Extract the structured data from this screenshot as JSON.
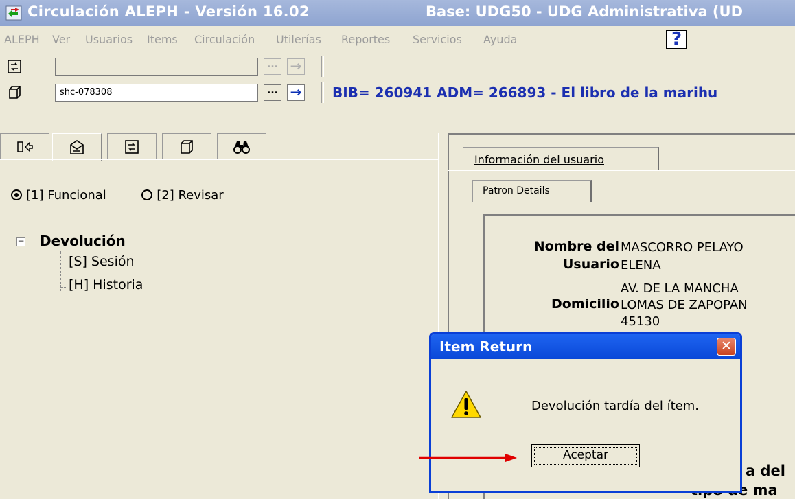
{
  "window": {
    "title": "Circulación ALEPH - Versión 16.02",
    "base": "Base:  UDG50 - UDG Administrativa (UD"
  },
  "menu": {
    "items": [
      "ALEPH",
      "Ver",
      "Usuarios",
      "Items",
      "Circulación",
      "Utilerías",
      "Reportes",
      "Servicios",
      "Ayuda"
    ],
    "help_label": "?"
  },
  "toolbar1": {
    "input_value": "",
    "dots_label": "...",
    "go_label": "→"
  },
  "toolbar2": {
    "input_value": "shc-078308",
    "dots_label": "...",
    "go_label": "→",
    "bib_info": "BIB= 260941 ADM= 266893 - El libro de la marihu"
  },
  "left_panel": {
    "tab_icons": [
      "return-icon",
      "mail-icon",
      "swap-icon",
      "window-icon",
      "binoculars-icon"
    ],
    "radio_functional": "[1] Funcional",
    "radio_review": "[2] Revisar",
    "tree_toggle": "−",
    "tree_root": "Devolución",
    "tree_children": [
      "[S] Sesión",
      "[H] Historia"
    ]
  },
  "right_panel": {
    "tab_user_info": "Información del usuario",
    "tab_patron_details": "Patron Details",
    "name_label_1": "Nombre del",
    "name_label_2": "Usuario",
    "name_value_1": "MASCORRO PELAYO",
    "name_value_2": "ELENA",
    "address_label": "Domicilio",
    "address_line_1": "AV. DE LA MANCHA",
    "address_line_2": "LOMAS DE ZAPOPAN",
    "address_line_3": "45130",
    "bottom_label_1": "a del",
    "bottom_label_2": "tipo de ma"
  },
  "dialog": {
    "title": "Item Return",
    "close_label": "✕",
    "message": "Devolución tardía del ítem.",
    "ok_label": "Aceptar"
  },
  "colors": {
    "titlebar": "#8ea4d0",
    "bib_text": "#1b2fb0",
    "dialog_title": "#0a48d8",
    "annotation_arrow": "#e00000"
  }
}
